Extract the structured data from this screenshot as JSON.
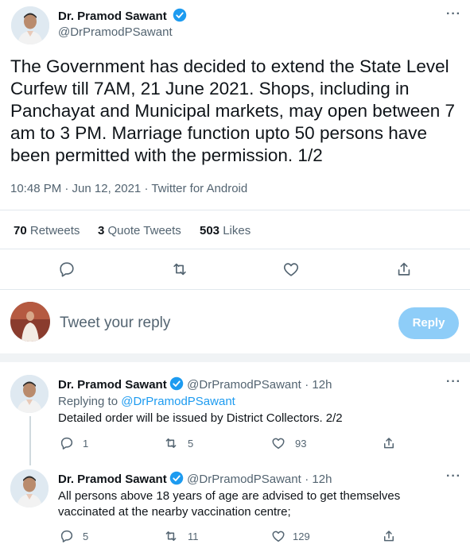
{
  "main_tweet": {
    "author_name": "Dr. Pramod Sawant",
    "author_handle": "@DrPramodPSawant",
    "text": "The Government has decided to extend the State Level Curfew till 7AM, 21 June 2021. Shops, including in Panchayat and Municipal markets, may open between 7 am to 3 PM. Marriage function upto 50 persons have been permitted with the permission. 1/2",
    "timestamp": "10:48 PM · Jun 12, 2021 · Twitter for Android",
    "retweets_count": "70",
    "retweets_label": "Retweets",
    "quote_count": "3",
    "quote_label": "Quote Tweets",
    "likes_count": "503",
    "likes_label": "Likes",
    "more": "···"
  },
  "reply_box": {
    "placeholder": "Tweet your reply",
    "button_label": "Reply"
  },
  "replies": [
    {
      "author_name": "Dr. Pramod Sawant",
      "author_handle": "@DrPramodPSawant",
      "time": "· 12h",
      "replying_prefix": "Replying to",
      "replying_to": "@DrPramodPSawant",
      "text": "Detailed order will be issued by District Collectors. 2/2",
      "reply_count": "1",
      "retweet_count": "5",
      "like_count": "93",
      "more": "···"
    },
    {
      "author_name": "Dr. Pramod Sawant",
      "author_handle": "@DrPramodPSawant",
      "time": "· 12h",
      "text": "All persons above 18 years of age are advised to get themselves vaccinated at the nearby vaccination centre;",
      "reply_count": "5",
      "retweet_count": "11",
      "like_count": "129",
      "more": "···"
    }
  ],
  "colors": {
    "accent": "#1d9bf0",
    "verified": "#1d9bf0",
    "reply_button": "#8ecdf8",
    "secondary_text": "#536471"
  },
  "icons": [
    "verified-badge-icon",
    "more-icon",
    "reply-icon",
    "retweet-icon",
    "like-icon",
    "share-icon"
  ]
}
